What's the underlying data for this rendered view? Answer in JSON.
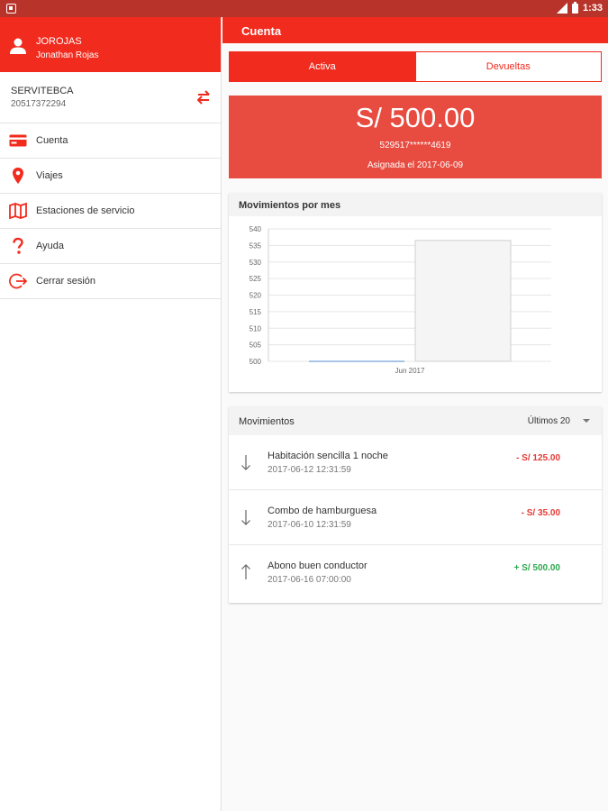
{
  "status_bar": {
    "time": "1:33"
  },
  "drawer": {
    "username": "JOROJAS",
    "fullname": "Jonathan Rojas",
    "company_name": "SERVITEBCA",
    "company_id": "20517372294",
    "items": [
      {
        "label": "Cuenta",
        "icon": "credit-card-icon"
      },
      {
        "label": "Viajes",
        "icon": "location-pin-icon"
      },
      {
        "label": "Estaciones de servicio",
        "icon": "map-icon"
      },
      {
        "label": "Ayuda",
        "icon": "question-icon"
      },
      {
        "label": "Cerrar sesión",
        "icon": "logout-icon"
      }
    ]
  },
  "appbar": {
    "title": "Cuenta"
  },
  "tabs": {
    "active": "Activa",
    "returned": "Devueltas"
  },
  "balance": {
    "amount": "S/ 500.00",
    "card_number": "529517******4619",
    "assigned": "Asignada el 2017-06-09"
  },
  "chart_card": {
    "title": "Movimientos por mes"
  },
  "chart_data": {
    "type": "bar",
    "categories": [
      "Jun 2017"
    ],
    "series": [
      {
        "values": [
          500
        ]
      },
      {
        "values": [
          536.5
        ]
      }
    ],
    "yticks": [
      500,
      505,
      510,
      515,
      520,
      525,
      530,
      535,
      540
    ],
    "ylim": [
      500,
      540
    ],
    "title": "",
    "xlabel": "",
    "ylabel": ""
  },
  "movements": {
    "title": "Movimientos",
    "filter": "Últimos 20",
    "rows": [
      {
        "direction": "down",
        "description": "Habitación sencilla 1 noche",
        "date": "2017-06-12 12:31:59",
        "amount": "- S/ 125.00",
        "kind": "neg"
      },
      {
        "direction": "down",
        "description": "Combo de hamburguesa",
        "date": "2017-06-10 12:31:59",
        "amount": "- S/ 35.00",
        "kind": "neg"
      },
      {
        "direction": "up",
        "description": "Abono buen conductor",
        "date": "2017-06-16 07:00:00",
        "amount": "+ S/ 500.00",
        "kind": "pos"
      }
    ]
  },
  "colors": {
    "brand": "#f12b1e",
    "negative": "#e53935",
    "positive": "#2fa84f",
    "bar_fill": "#f5f5f5",
    "bar_line": "#a9c4e6"
  }
}
